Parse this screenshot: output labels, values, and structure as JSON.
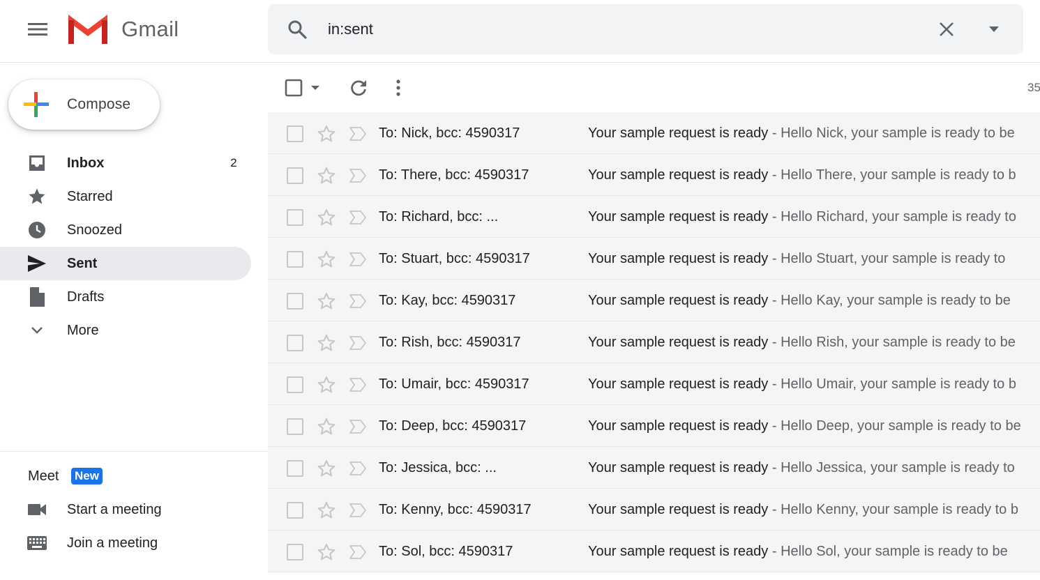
{
  "app": {
    "name": "Gmail"
  },
  "search": {
    "query": "in:sent"
  },
  "compose": {
    "label": "Compose"
  },
  "nav": {
    "items": [
      {
        "label": "Inbox",
        "count": "2",
        "bold": true
      },
      {
        "label": "Starred"
      },
      {
        "label": "Snoozed"
      },
      {
        "label": "Sent",
        "active": true,
        "bold": true
      },
      {
        "label": "Drafts"
      },
      {
        "label": "More"
      }
    ]
  },
  "meet": {
    "title": "Meet",
    "badge": "New",
    "items": [
      {
        "label": "Start a meeting"
      },
      {
        "label": "Join a meeting"
      }
    ]
  },
  "toolbar": {
    "page_count": "35"
  },
  "colors": {
    "accent": "#1a73e8",
    "active_nav": "#e8eaed",
    "row_bg": "#f5f5f5",
    "gmail_red": "#ea4335"
  },
  "emails": [
    {
      "recipient": "To: Nick, bcc: 4590317",
      "subject": "Your sample request is ready",
      "snippet": " - Hello Nick, your sample is ready to be"
    },
    {
      "recipient": "To: There, bcc: 4590317",
      "subject": "Your sample request is ready",
      "snippet": " - Hello There, your sample is ready to b"
    },
    {
      "recipient": "To: Richard, bcc:  ...",
      "subject": "Your sample request is ready",
      "snippet": " - Hello Richard, your sample is ready to"
    },
    {
      "recipient": "To: Stuart, bcc: 4590317",
      "subject": "Your sample request is ready",
      "snippet": " - Hello Stuart, your sample is ready to"
    },
    {
      "recipient": "To: Kay, bcc: 4590317",
      "subject": "Your sample request is ready",
      "snippet": " - Hello Kay, your sample is ready to be"
    },
    {
      "recipient": "To: Rish, bcc: 4590317",
      "subject": "Your sample request is ready",
      "snippet": " - Hello Rish, your sample is ready to be"
    },
    {
      "recipient": "To: Umair, bcc: 4590317",
      "subject": "Your sample request is ready",
      "snippet": " - Hello Umair, your sample is ready to b"
    },
    {
      "recipient": "To: Deep, bcc: 4590317",
      "subject": "Your sample request is ready",
      "snippet": " - Hello Deep, your sample is ready to be"
    },
    {
      "recipient": "To: Jessica, bcc:  ...",
      "subject": "Your sample request is ready",
      "snippet": " - Hello Jessica, your sample is ready to"
    },
    {
      "recipient": "To: Kenny, bcc: 4590317",
      "subject": "Your sample request is ready",
      "snippet": " - Hello Kenny, your sample is ready to b"
    },
    {
      "recipient": "To: Sol, bcc: 4590317",
      "subject": "Your sample request is ready",
      "snippet": " - Hello Sol, your sample is ready to be"
    }
  ]
}
